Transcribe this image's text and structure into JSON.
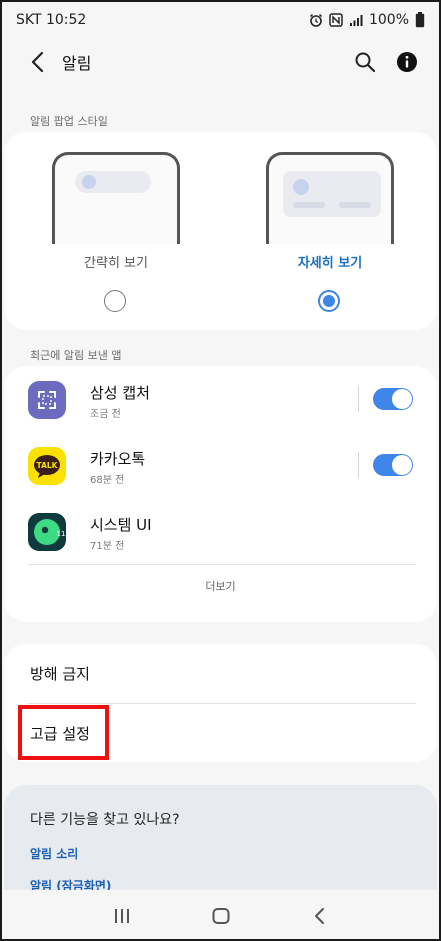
{
  "status_bar": {
    "carrier_time": "SKT 10:52",
    "battery": "100%",
    "icons": [
      "alarm-icon",
      "nfc-icon",
      "signal-icon",
      "battery-icon"
    ]
  },
  "app_bar": {
    "title": "알림",
    "icons": [
      "back-icon",
      "search-icon",
      "info-icon"
    ]
  },
  "popup_style": {
    "section_label": "알림 팝업 스타일",
    "options": [
      {
        "label": "간략히 보기",
        "selected": false
      },
      {
        "label": "자세히 보기",
        "selected": true
      }
    ]
  },
  "recent_apps": {
    "section_label": "최근에 알림 보낸 앱",
    "items": [
      {
        "name": "삼성 캡처",
        "time": "조금 전",
        "icon": "samsung-capture-icon",
        "toggle_on": true
      },
      {
        "name": "카카오톡",
        "time": "68분 전",
        "icon": "kakaotalk-icon",
        "icon_text": "TALK",
        "toggle_on": true
      },
      {
        "name": "시스템 UI",
        "time": "71분 전",
        "icon": "system-ui-icon",
        "icon_text": "11"
      }
    ],
    "more_label": "더보기"
  },
  "settings": {
    "items": [
      {
        "label": "방해 금지"
      },
      {
        "label": "고급 설정",
        "highlighted": true
      }
    ]
  },
  "suggestions": {
    "title": "다른 기능을 찾고 있나요?",
    "links": [
      "알림 소리",
      "알림 (잠금화면)"
    ]
  },
  "nav_bar": {
    "icons": [
      "recent-apps-icon",
      "home-icon",
      "back-icon"
    ]
  },
  "colors": {
    "accent": "#3e86e8",
    "selected_text": "#1a6ec4",
    "link": "#1a5fb4",
    "highlight": "#ee1111",
    "kakao_yellow": "#fae100",
    "capture_purple": "#6b6bc0",
    "system_ui_dark": "#0f3b3e"
  }
}
